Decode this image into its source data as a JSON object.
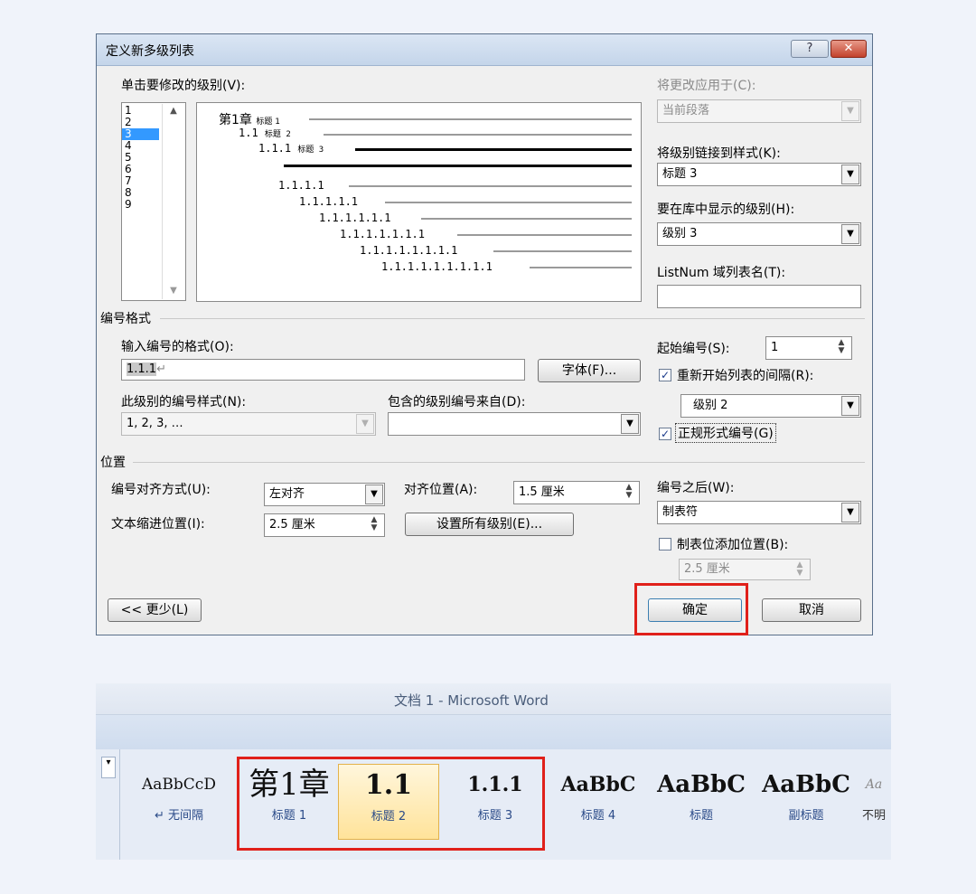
{
  "dialog": {
    "title": "定义新多级列表",
    "help_button": "?",
    "close_button": "✕",
    "click_level_label": "单击要修改的级别(V):",
    "levels": [
      {
        "label": "1",
        "selected": false
      },
      {
        "label": "2",
        "selected": false
      },
      {
        "label": "3",
        "selected": true
      },
      {
        "label": "4",
        "selected": false
      },
      {
        "label": "5",
        "selected": false
      },
      {
        "label": "6",
        "selected": false
      },
      {
        "label": "7",
        "selected": false
      },
      {
        "label": "8",
        "selected": false
      },
      {
        "label": "9",
        "selected": false
      }
    ],
    "preview": {
      "line1": "第1章",
      "line1_style": "标题 1",
      "line2": "1.1",
      "line2_style": "标题 2",
      "line3": "1.1.1",
      "line3_style": "标题 3",
      "line5": "1.1.1.1",
      "line6": "1.1.1.1.1",
      "line7": "1.1.1.1.1.1",
      "line8": "1.1.1.1.1.1.1",
      "line9": "1.1.1.1.1.1.1.1",
      "line10": "1.1.1.1.1.1.1.1.1"
    },
    "apply_to_label": "将更改应用于(C):",
    "apply_to_value": "当前段落",
    "link_style_label": "将级别链接到样式(K):",
    "link_style_value": "标题 3",
    "gallery_level_label": "要在库中显示的级别(H):",
    "gallery_level_value": "级别 3",
    "listnum_label": "ListNum 域列表名(T):",
    "listnum_value": "",
    "number_format_section": "编号格式",
    "enter_format_label": "输入编号的格式(O):",
    "format_value": "1.1.1",
    "format_mark": "↵",
    "font_button": "字体(F)...",
    "number_style_label": "此级别的编号样式(N):",
    "number_style_value": "1, 2, 3, …",
    "include_level_label": "包含的级别编号来自(D):",
    "include_level_value": "",
    "start_at_label": "起始编号(S):",
    "start_at_value": "1",
    "restart_label": "重新开始列表的间隔(R):",
    "restart_checked": "✓",
    "restart_value": "级别 2",
    "legal_label": "正规形式编号(G)",
    "legal_checked": "✓",
    "position_section": "位置",
    "alignment_label": "编号对齐方式(U):",
    "alignment_value": "左对齐",
    "aligned_at_label": "对齐位置(A):",
    "aligned_at_value": "1.5 厘米",
    "indent_label": "文本缩进位置(I):",
    "indent_value": "2.5 厘米",
    "set_all_levels_button": "设置所有级别(E)...",
    "follow_number_label": "编号之后(W):",
    "follow_number_value": "制表符",
    "tab_stop_label": "制表位添加位置(B):",
    "tab_stop_value": "2.5 厘米",
    "less_button": "<< 更少(L)",
    "ok_button": "确定",
    "cancel_button": "取消"
  },
  "word": {
    "title": "文档 1 - Microsoft Word",
    "styles": [
      {
        "sample": "AaBbCcD",
        "name": "↵ 无间隔"
      },
      {
        "sample": "第1章",
        "name": "标题 1"
      },
      {
        "sample": "1.1",
        "name": "标题 2"
      },
      {
        "sample": "1.1.1",
        "name": "标题 3"
      },
      {
        "sample": "AaBbC",
        "name": "标题 4"
      },
      {
        "sample": "AaBbC",
        "name": "标题"
      },
      {
        "sample": "AaBbC",
        "name": "副标题"
      },
      {
        "sample": "Aa",
        "name": "不明"
      }
    ]
  },
  "colors": {
    "highlight": "#e0201a",
    "selection": "#3399ff",
    "checkmark": "#1a3a8a"
  }
}
